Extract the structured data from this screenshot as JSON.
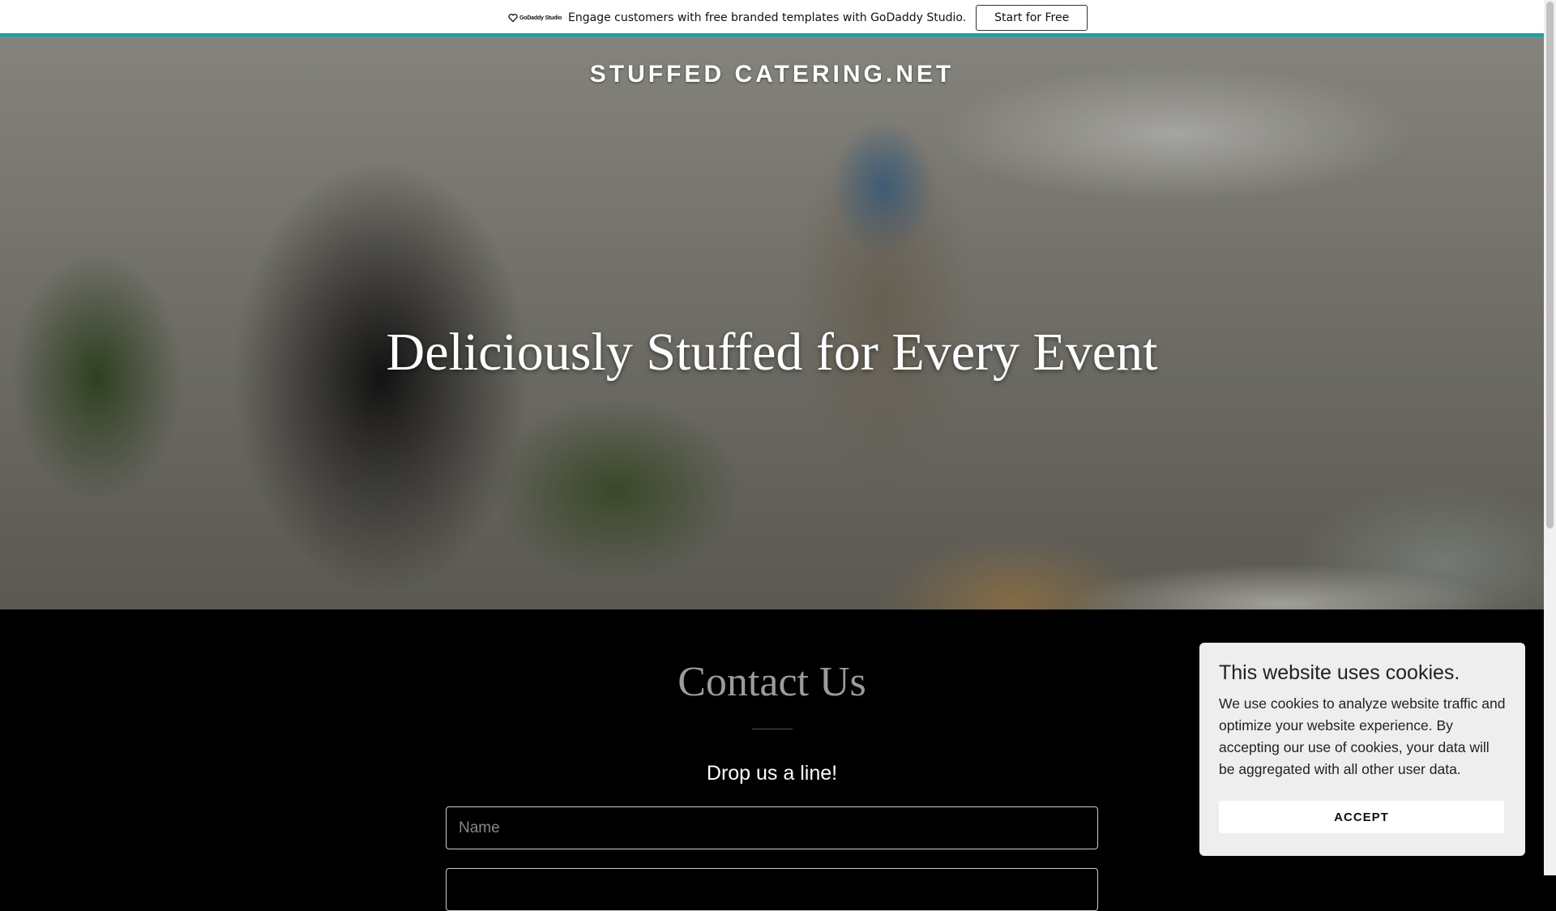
{
  "promo": {
    "logo_text": "GoDaddy Studio",
    "message": "Engage customers with free branded templates with GoDaddy Studio.",
    "button_label": "Start for Free"
  },
  "hero": {
    "site_title": "STUFFED CATERING.NET",
    "heading": "Deliciously Stuffed for Every Event"
  },
  "contact": {
    "title": "Contact Us",
    "subheading": "Drop us a line!",
    "name_placeholder": "Name",
    "email_placeholder": ""
  },
  "cookie": {
    "title": "This website uses cookies.",
    "text": "We use cookies to analyze website traffic and optimize your website experience. By accepting our use of cookies, your data will be aggregated with all other user data.",
    "accept_label": "ACCEPT"
  },
  "colors": {
    "accent": "#17a2a8",
    "background": "#000000",
    "cookie_panel": "#eeeeee"
  }
}
